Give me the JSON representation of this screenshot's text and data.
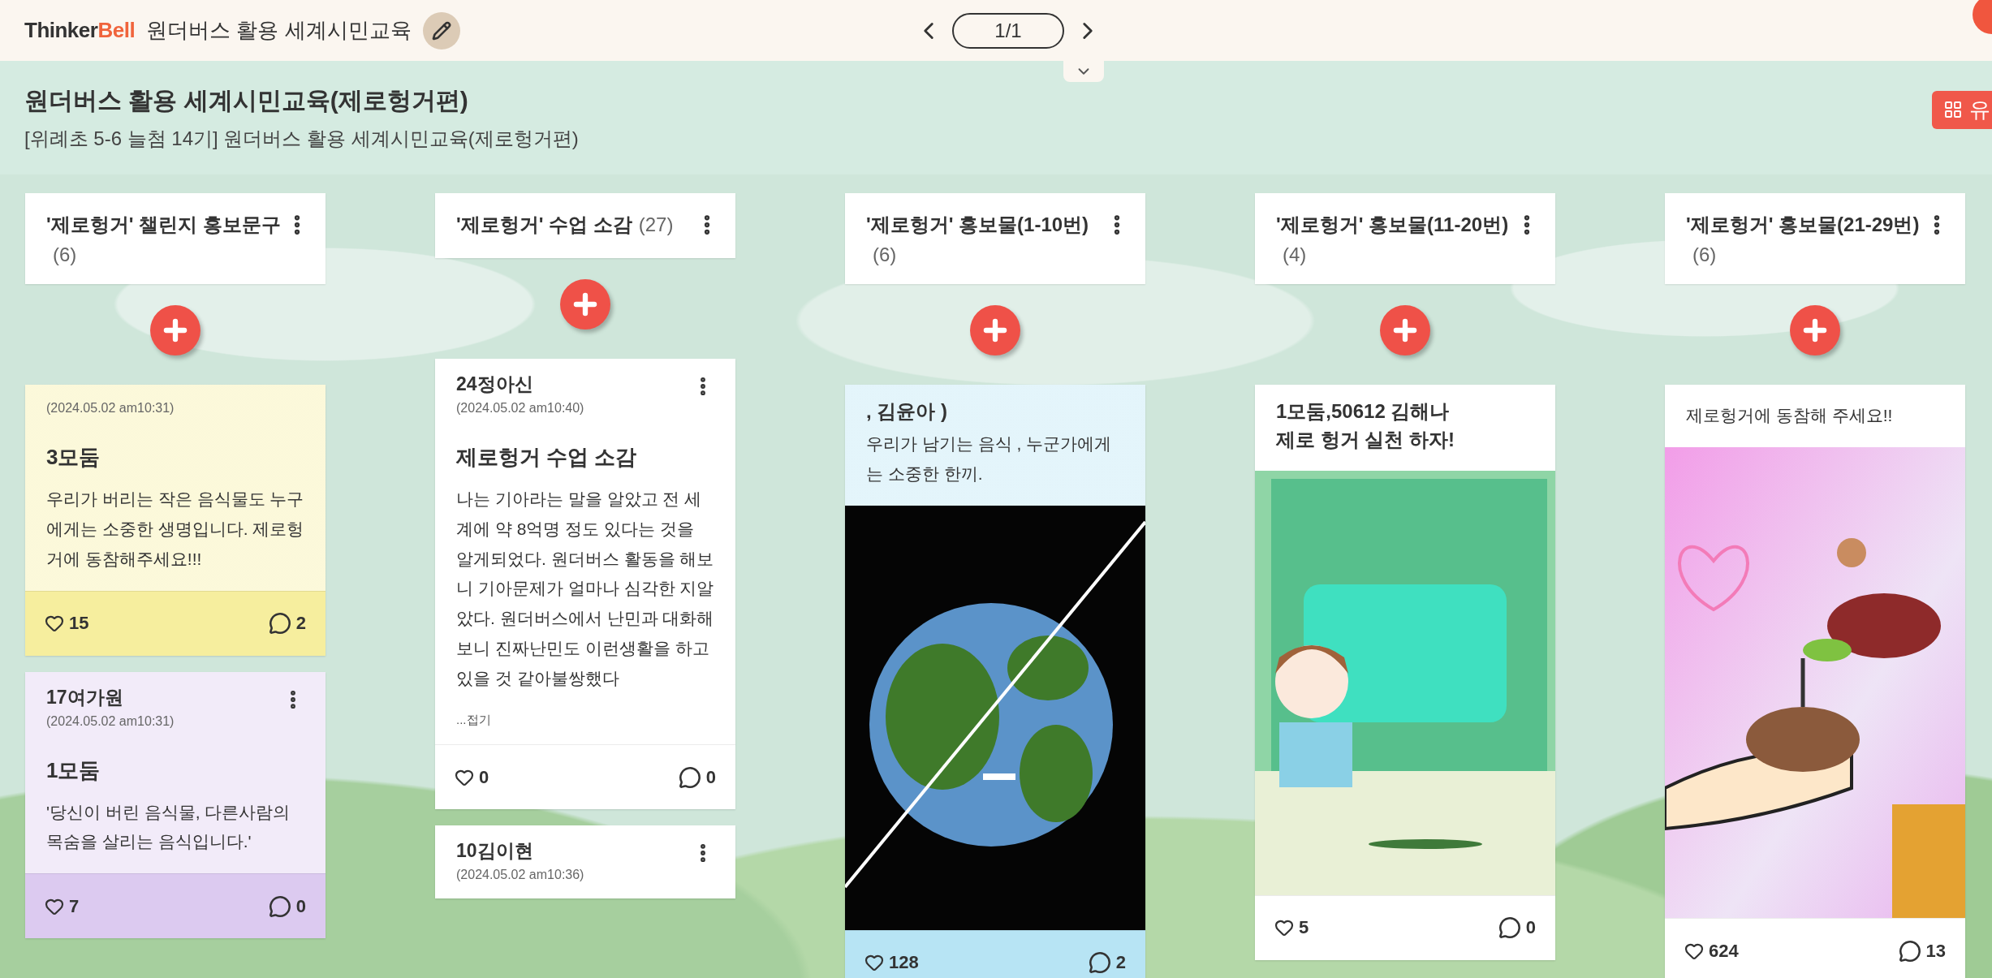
{
  "top_bar": {
    "logo_dark": "Thinker",
    "logo_accent": "Bell",
    "board_name": "원더버스 활용 세계시민교육",
    "pager": "1/1"
  },
  "header": {
    "title": "원더버스 활용 세계시민교육(제로헝거편)",
    "subtitle": "[위례초 5-6 늘첨 14기] 원더버스 활용 세계시민교육(제로헝거편)",
    "action_label": "유"
  },
  "columns": [
    {
      "title": "'제로헝거' 챌린지 홍보문구",
      "count": "(6)",
      "cards": [
        {
          "color": "#f6ee9e",
          "date": "(2024.05.02 am10:31)",
          "title": "3모둠",
          "text": "우리가 버리는 작은 음식물도 누구에게는 소중한 생명입니다. 제로헝거에 동참해주세요!!!",
          "likes": "15",
          "comments": "2"
        },
        {
          "color": "#dccaf0",
          "author": "17여가원",
          "date": "(2024.05.02 am10:31)",
          "title": "1모둠",
          "text": "'당신이 버린 음식물, 다른사람의 목숨을 살리는 음식입니다.'",
          "likes": "7",
          "comments": "0"
        }
      ]
    },
    {
      "title": "'제로헝거' 수업 소감",
      "count": "(27)",
      "cards": [
        {
          "color": "#ffffff",
          "author": "24정아신",
          "date": "(2024.05.02 am10:40)",
          "title": "제로헝거 수업 소감",
          "text": "나는 기아라는 말을 알았고 전 세계에 약 8억명 정도 있다는 것을 알게되었다. 원더버스 활동을 해보니 기아문제가 얼마나 심각한 지알았다. 원더버스에서 난민과 대화해보니 진짜난민도 이런생활을 하고있을 것 같아불쌍했다",
          "fold": "...접기",
          "likes": "0",
          "comments": "0"
        },
        {
          "color": "#ffffff",
          "author": "10김이현",
          "date": "(2024.05.02 am10:36)"
        }
      ]
    },
    {
      "title": "'제로헝거' 홍보물(1-10번)",
      "count": "(6)",
      "cards": [
        {
          "color": "#b7e4f4",
          "heading_lines": [
            ", 김윤아 )"
          ],
          "text": "우리가 남기는 음식 , 누군가에게는 소중한 한끼.",
          "picture": {
            "kind": "picture"
          },
          "likes": "128",
          "comments": "2"
        }
      ]
    },
    {
      "title": "'제로헝거' 홍보물(11-20번)",
      "count": "(4)",
      "cards": [
        {
          "color": "#ffffff",
          "heading_lines": [
            "1모둠,50612 김해나",
            "제로 헝거 실천 하자!"
          ],
          "picture": {
            "kind": "picture"
          },
          "likes": "5",
          "comments": "0"
        }
      ]
    },
    {
      "title": "'제로헝거' 홍보물(21-29번)",
      "count": "(6)",
      "cards": [
        {
          "color": "#ffffff",
          "text": "제로헝거에 동참해 주세요!!",
          "picture": {
            "kind": "picture"
          },
          "likes": "624",
          "comments": "13"
        }
      ]
    }
  ]
}
